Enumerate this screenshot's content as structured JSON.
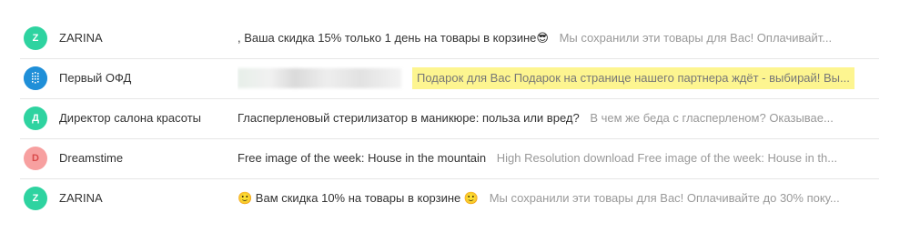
{
  "emails": [
    {
      "avatar_letter": "Z",
      "avatar_color": "#2ed3a0",
      "sender": "ZARINA",
      "subject": ", Ваша скидка 15% только 1 день на товары в корзине😎",
      "preview": "Мы сохранили эти товары для Вас! Оплачивайт..."
    },
    {
      "avatar_icon": "ofd-logo-icon",
      "avatar_color": "#1f8fd8",
      "sender": "Первый ОФД",
      "subject_blurred": true,
      "highlighted_text": "Подарок для Вас Подарок на странице нашего партнера ждёт - выбирай! Вы..."
    },
    {
      "avatar_letter": "Д",
      "avatar_color": "#2ed3a0",
      "sender": "Директор салона красоты",
      "subject": "Гласперленовый стерилизатор в маникюре: польза или вред?",
      "preview": "В чем же беда с гласперленом? Оказывае..."
    },
    {
      "avatar_letter": "D",
      "avatar_color": "#f7a0a0",
      "avatar_text_color": "#d94a4a",
      "sender": "Dreamstime",
      "subject": "Free image of the week: House in the mountain",
      "preview": "High Resolution download Free image of the week: House in th..."
    },
    {
      "avatar_letter": "Z",
      "avatar_color": "#2ed3a0",
      "sender": "ZARINA",
      "subject": "🙂 Вам скидка 10% на товары в корзине 🙂",
      "preview": "Мы сохранили эти товары для Вас! Оплачивайте до 30% поку..."
    }
  ]
}
